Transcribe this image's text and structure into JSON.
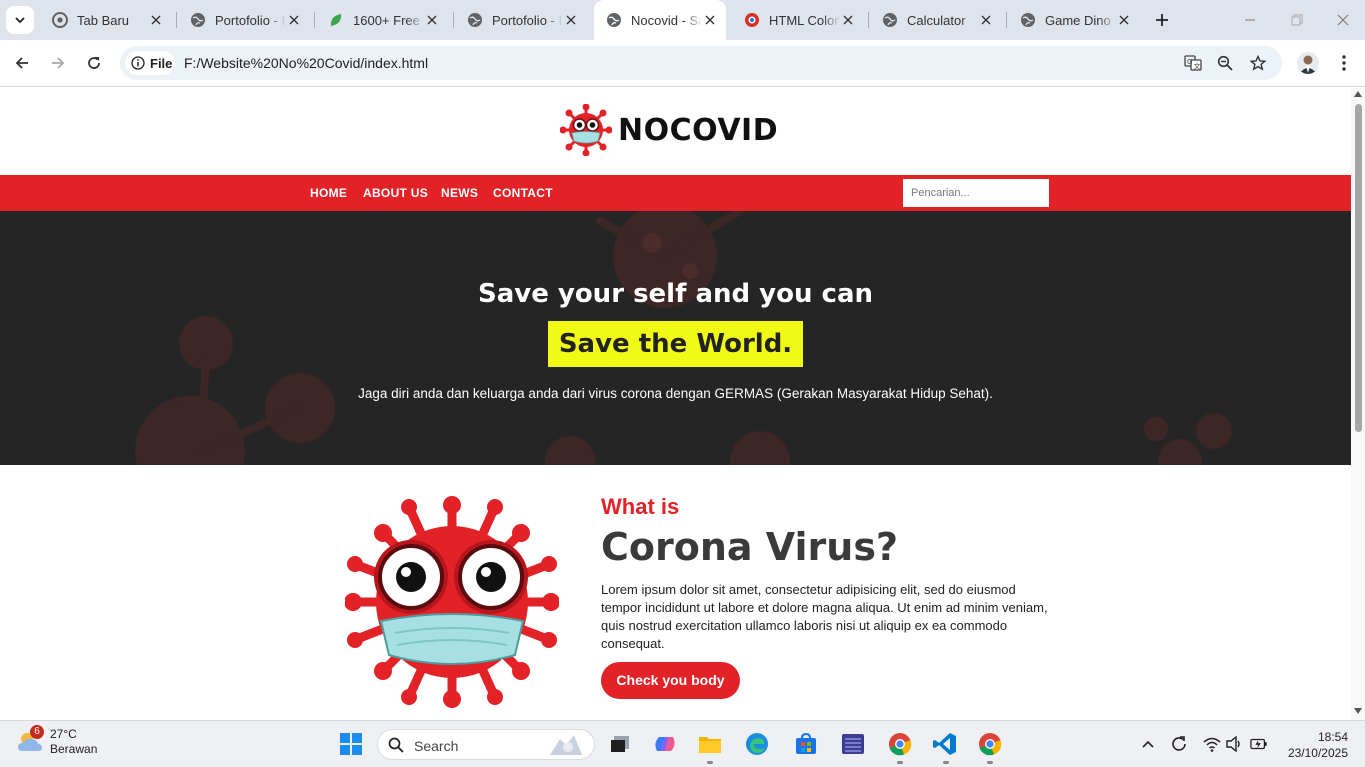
{
  "browser": {
    "tabs": [
      {
        "title": "Tab Baru",
        "icon": "chrome-icon",
        "active": false
      },
      {
        "title": "Portofolio - I",
        "icon": "globe-icon",
        "active": false
      },
      {
        "title": "1600+ Free E",
        "icon": "leaf-icon",
        "active": false
      },
      {
        "title": "Portofolio - I",
        "icon": "globe-icon",
        "active": false
      },
      {
        "title": "Nocovid - Sa",
        "icon": "globe-icon",
        "active": true
      },
      {
        "title": "HTML Color",
        "icon": "color-icon",
        "active": false
      },
      {
        "title": "Calculator",
        "icon": "globe-icon",
        "active": false
      },
      {
        "title": "Game Dino F",
        "icon": "globe-icon",
        "active": false
      }
    ],
    "chip_label": "File",
    "url": "F:/Website%20No%20Covid/index.html"
  },
  "site": {
    "brand": "NOCOVID",
    "nav": [
      "HOME",
      "ABOUT US",
      "NEWS",
      "CONTACT"
    ],
    "search_placeholder": "Pencarian...",
    "hero": {
      "title": "Save your self and you can",
      "highlight": "Save the World.",
      "subtitle": "Jaga diri anda dan keluarga anda dari virus corona dengan GERMAS (Gerakan Masyarakat Hidup Sehat)."
    },
    "about": {
      "eyebrow": "What is",
      "title": "Corona Virus?",
      "text": "Lorem ipsum dolor sit amet, consectetur adipisicing elit, sed do eiusmod tempor incididunt ut labore et dolore magna aliqua. Ut enim ad minim veniam, quis nostrud exercitation ullamco laboris nisi ut aliquip ex ea commodo consequat.",
      "button": "Check you body"
    },
    "colors": {
      "accent": "#e32228",
      "highlight": "#f1fa14",
      "hero_bg": "#252525"
    }
  },
  "taskbar": {
    "weather_badge": "6",
    "temperature": "27°C",
    "condition": "Berawan",
    "search_label": "Search",
    "time": "18:54",
    "date": "23/10/2025"
  }
}
